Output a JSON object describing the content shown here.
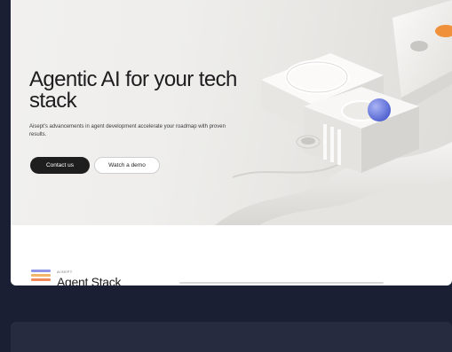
{
  "hero": {
    "headline": "Agentic AI for your tech stack",
    "subtext": "Aisept's advancements in agent development accelerate your roadmap with proven results.",
    "primary_button": "Contact us",
    "secondary_button": "Watch a demo"
  },
  "stack_section": {
    "eyebrow": "AISEPT",
    "title": "Agent Stack",
    "logo_colors": [
      "#8f95e6",
      "#f3b56b",
      "#f08a5b"
    ]
  },
  "colors": {
    "page_background": "#1b1f33",
    "accent_orange": "#f0903a",
    "accent_sphere": "#6f7fe0"
  }
}
